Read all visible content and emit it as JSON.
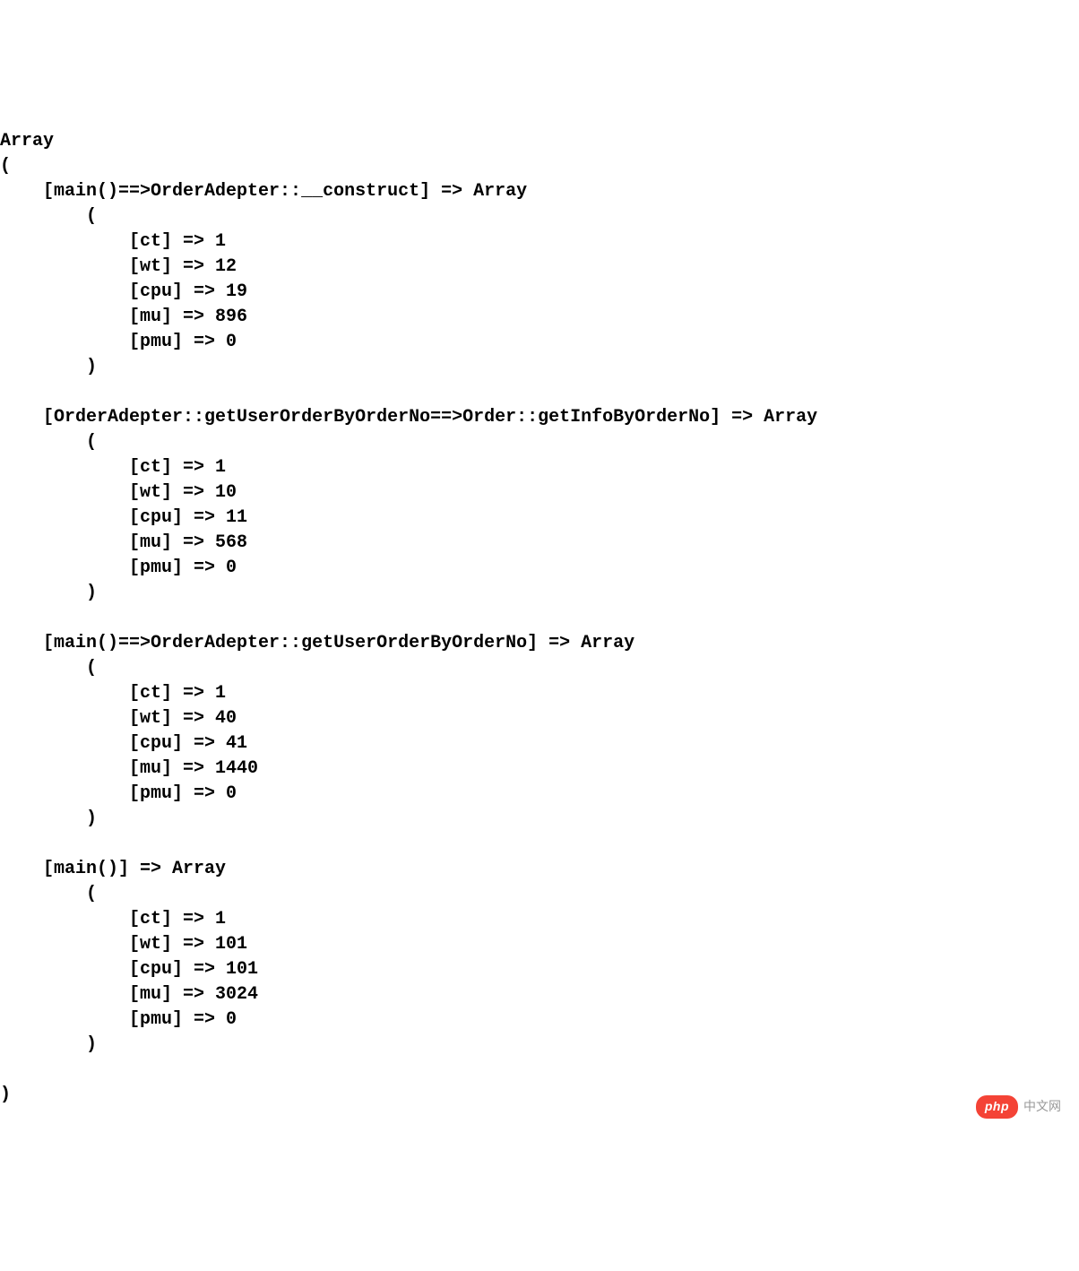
{
  "root_label": "Array",
  "entries": [
    {
      "key": "[main()==>OrderAdepter::__construct] => Array",
      "metrics": {
        "ct": "1",
        "wt": "12",
        "cpu": "19",
        "mu": "896",
        "pmu": "0"
      }
    },
    {
      "key": "[OrderAdepter::getUserOrderByOrderNo==>Order::getInfoByOrderNo] => Array",
      "metrics": {
        "ct": "1",
        "wt": "10",
        "cpu": "11",
        "mu": "568",
        "pmu": "0"
      }
    },
    {
      "key": "[main()==>OrderAdepter::getUserOrderByOrderNo] => Array",
      "metrics": {
        "ct": "1",
        "wt": "40",
        "cpu": "41",
        "mu": "1440",
        "pmu": "0"
      }
    },
    {
      "key": "[main()] => Array",
      "metrics": {
        "ct": "1",
        "wt": "101",
        "cpu": "101",
        "mu": "3024",
        "pmu": "0"
      }
    }
  ],
  "watermark": {
    "badge": "php",
    "text": "中文网"
  }
}
